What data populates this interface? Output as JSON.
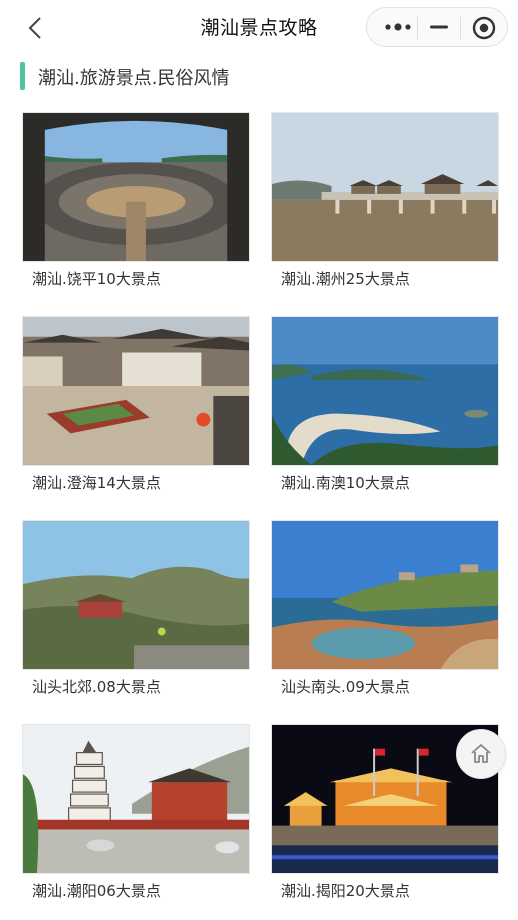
{
  "nav": {
    "title": "潮汕景点攻略",
    "back_icon": "chevron-left-icon",
    "more_icon": "more-dots-icon",
    "minimize_icon": "minimize-icon",
    "close_icon": "target-close-icon"
  },
  "section": {
    "title": "潮汕.旅游景点.民俗风情",
    "accent_color": "#4fc3a1"
  },
  "cards": [
    {
      "label": "潮汕.饶平10大景点"
    },
    {
      "label": "潮汕.潮州25大景点"
    },
    {
      "label": "潮汕.澄海14大景点"
    },
    {
      "label": "潮汕.南澳10大景点"
    },
    {
      "label": "汕头北郊.08大景点"
    },
    {
      "label": "汕头南头.09大景点"
    },
    {
      "label": "潮汕.潮阳06大景点"
    },
    {
      "label": "潮汕.揭阳20大景点"
    }
  ],
  "home_button": {
    "icon": "home-icon"
  }
}
